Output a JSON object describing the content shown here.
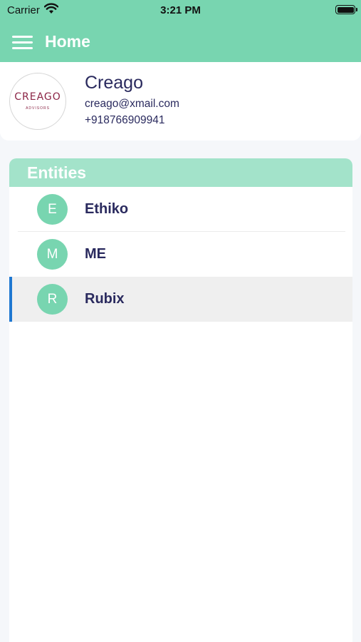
{
  "status_bar": {
    "carrier": "Carrier",
    "time": "3:21 PM",
    "wifi_icon": "wifi-icon",
    "battery_icon": "battery-icon"
  },
  "nav": {
    "menu_icon": "hamburger-menu-icon",
    "title": "Home"
  },
  "profile": {
    "logo_text": "CREAGO",
    "logo_subtext": "ADVISORS",
    "name": "Creago",
    "email": "creago@xmail.com",
    "phone": "+918766909941"
  },
  "entities": {
    "title": "Entities",
    "items": [
      {
        "initial": "E",
        "name": "Ethiko",
        "selected": false
      },
      {
        "initial": "M",
        "name": "ME",
        "selected": false
      },
      {
        "initial": "R",
        "name": "Rubix",
        "selected": true
      }
    ]
  },
  "colors": {
    "accent": "#78d5b0",
    "header_light": "#a3e3ca",
    "text": "#2a2a5e",
    "selection_bar": "#1f78d1",
    "logo": "#8b2445"
  }
}
